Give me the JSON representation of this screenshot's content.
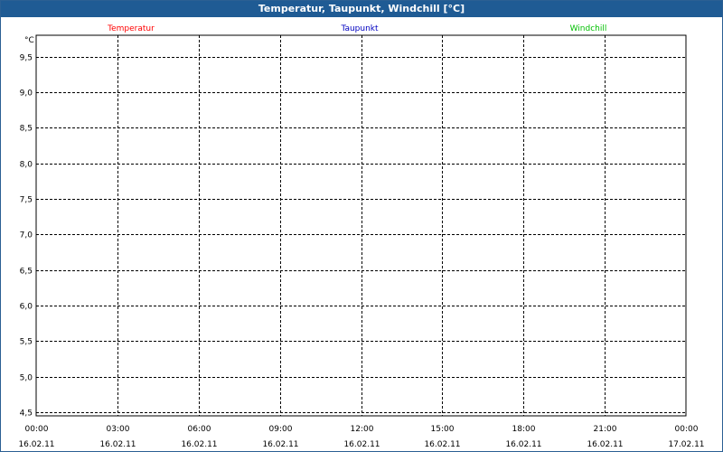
{
  "window": {
    "title": "Temperatur, Taupunkt, Windchill [°C]"
  },
  "chart_data": {
    "type": "line",
    "title": "Temperatur, Taupunkt, Windchill [°C]",
    "ylabel": "°C",
    "xlabel": "",
    "ylim": [
      4.45,
      9.8
    ],
    "yticks": [
      "9,5",
      "9,0",
      "8,5",
      "8,0",
      "7,5",
      "7,0",
      "6,5",
      "6,0",
      "5,5",
      "5,0",
      "4,5"
    ],
    "ytick_values": [
      9.5,
      9.0,
      8.5,
      8.0,
      7.5,
      7.0,
      6.5,
      6.0,
      5.5,
      5.0,
      4.5
    ],
    "xticks": [
      {
        "time": "00:00",
        "date": "16.02.11"
      },
      {
        "time": "03:00",
        "date": "16.02.11"
      },
      {
        "time": "06:00",
        "date": "16.02.11"
      },
      {
        "time": "09:00",
        "date": "16.02.11"
      },
      {
        "time": "12:00",
        "date": "16.02.11"
      },
      {
        "time": "15:00",
        "date": "16.02.11"
      },
      {
        "time": "18:00",
        "date": "16.02.11"
      },
      {
        "time": "21:00",
        "date": "16.02.11"
      },
      {
        "time": "00:00",
        "date": "17.02.11"
      }
    ],
    "grid": true,
    "legend_placement": "top",
    "series": [
      {
        "name": "Temperatur",
        "color": "#ff0000",
        "values": []
      },
      {
        "name": "Taupunkt",
        "color": "#0000c0",
        "values": []
      },
      {
        "name": "Windchill",
        "color": "#00c000",
        "values": []
      }
    ]
  }
}
